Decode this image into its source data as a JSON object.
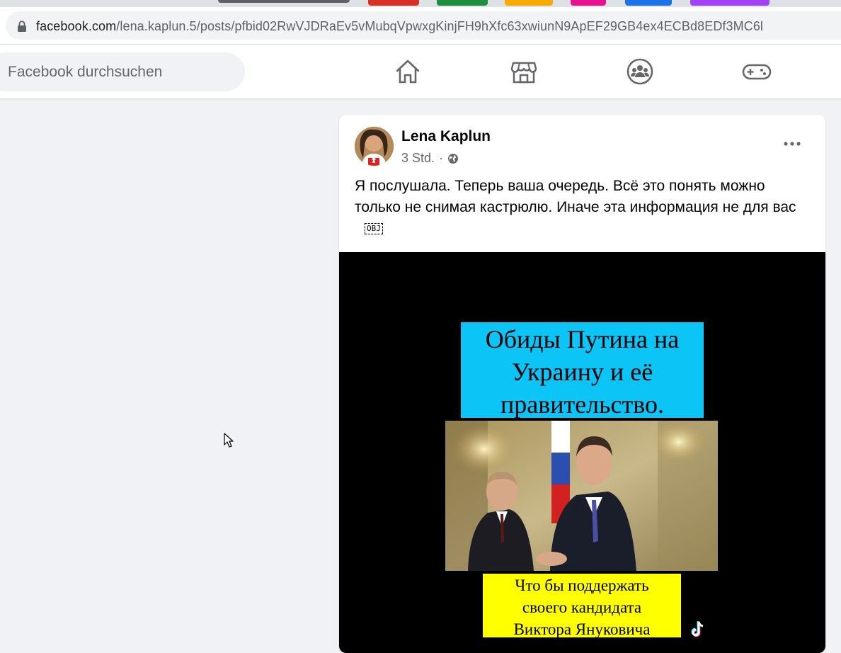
{
  "browser": {
    "url_domain": "facebook.com",
    "url_path": "/lena.kaplun.5/posts/pfbid02RwVJDRaEv5vMubqVpwxgKinjFH9hXfc63xwiunN9ApEF29GB4ex4ECBd8EDf3MC6l",
    "tab_colors": [
      "#9aa0a6",
      "#5f6368",
      "#d93025",
      "#1e8e3e",
      "#f9ab00",
      "#1a73e8",
      "#a142f4"
    ]
  },
  "facebook": {
    "search_placeholder": "Facebook durchsuchen",
    "nav_icons": [
      "home-icon",
      "marketplace-icon",
      "groups-icon",
      "gaming-icon"
    ]
  },
  "post": {
    "author": "Lena Kaplun",
    "time": "3 Std.",
    "separator": "·",
    "audience_icon": "globe-icon",
    "text": "Я послушала. Теперь ваша очередь. Всё это понять можно только не снимая кастрюлю. Иначе эта информация не для вас",
    "obj_placeholder": "OBJ",
    "video": {
      "title_lines": [
        "Обиды Путина на",
        "Украину и её",
        "правительство."
      ],
      "caption_lines": [
        "Что бы поддержать",
        "своего кандидата",
        "Виктора Януковича"
      ],
      "title_bg": "#0cc4f6",
      "caption_bg": "#ffff00",
      "watermark_icon": "tiktok-icon"
    }
  }
}
